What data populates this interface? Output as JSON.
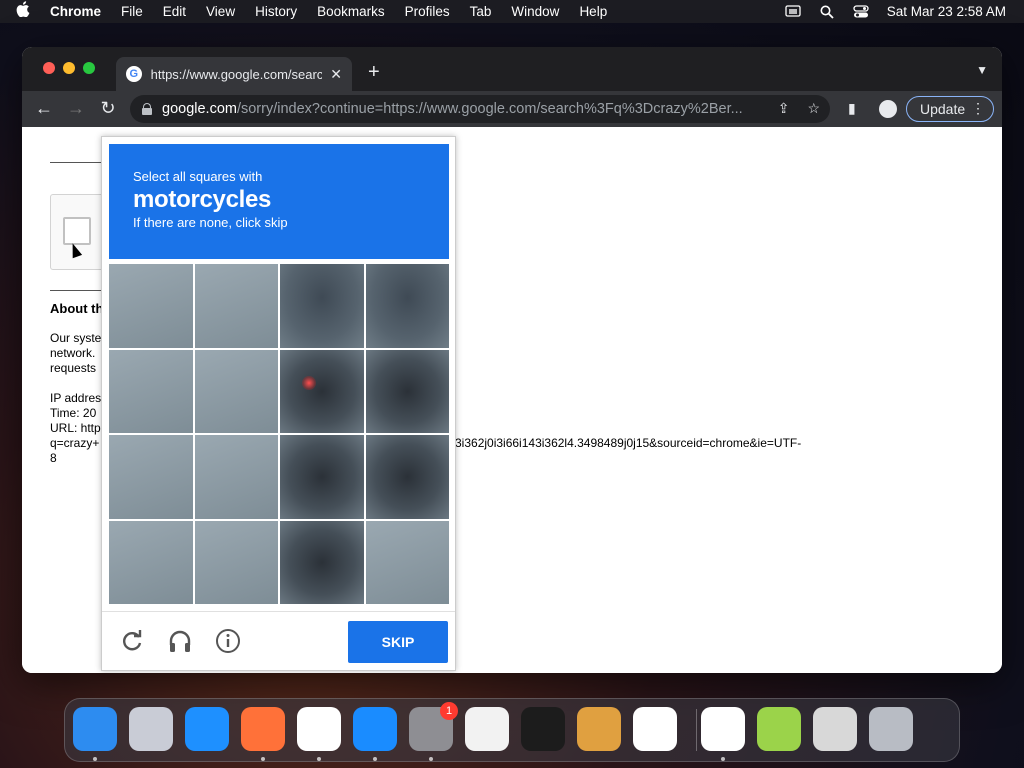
{
  "menubar": {
    "apple_icon": "apple-logo-icon",
    "app_name": "Chrome",
    "items": [
      "File",
      "Edit",
      "View",
      "History",
      "Bookmarks",
      "Profiles",
      "Tab",
      "Window",
      "Help"
    ],
    "datetime": "Sat Mar 23  2:58 AM"
  },
  "browser": {
    "tab_title": "https://www.google.com/search",
    "url_domain": "google.com",
    "url_rest": "/sorry/index?continue=https://www.google.com/search%3Fq%3Dcrazy%2Ber...",
    "update_label": "Update"
  },
  "page": {
    "about_heading": "About th",
    "lines": [
      "Our syste",
      "network.",
      "requests"
    ],
    "ip_line": "IP addres",
    "time_line": "Time: 20",
    "url_line1": "URL: http",
    "url_line2": "q=crazy+",
    "url_tail": "3i362j0i3i66i143i362l4.3498489j0j15&sourceid=chrome&ie=UTF-",
    "url_tail2": "8"
  },
  "captcha": {
    "instruction": "Select all squares with",
    "target": "motorcycles",
    "hint": "If there are none, click skip",
    "skip_label": "SKIP",
    "cells": [
      "light",
      "light",
      "rider",
      "rider",
      "light",
      "light",
      "dark",
      "dark",
      "light",
      "light",
      "dark",
      "dark",
      "light",
      "light",
      "dark",
      "light"
    ]
  },
  "dock": {
    "apps": [
      {
        "name": "finder",
        "color": "#2d8cf0"
      },
      {
        "name": "launchpad",
        "color": "#c9ccd6"
      },
      {
        "name": "safari",
        "color": "#1e90ff"
      },
      {
        "name": "firefox",
        "color": "#ff7139"
      },
      {
        "name": "chrome",
        "color": "#ffffff"
      },
      {
        "name": "app-store",
        "color": "#1a8cff"
      },
      {
        "name": "system-settings",
        "color": "#8e8e93",
        "badge": "1"
      },
      {
        "name": "textedit",
        "color": "#f2f2f2"
      },
      {
        "name": "terminal",
        "color": "#1c1c1c"
      },
      {
        "name": "garageband",
        "color": "#e0a040"
      },
      {
        "name": "vscode",
        "color": "#ffffff"
      },
      {
        "name": "visual-studio",
        "color": "#ffffff"
      },
      {
        "name": "game",
        "color": "#9bd34a"
      },
      {
        "name": "chess",
        "color": "#d8d8d8"
      },
      {
        "name": "trash",
        "color": "#b8bcc4"
      }
    ]
  }
}
